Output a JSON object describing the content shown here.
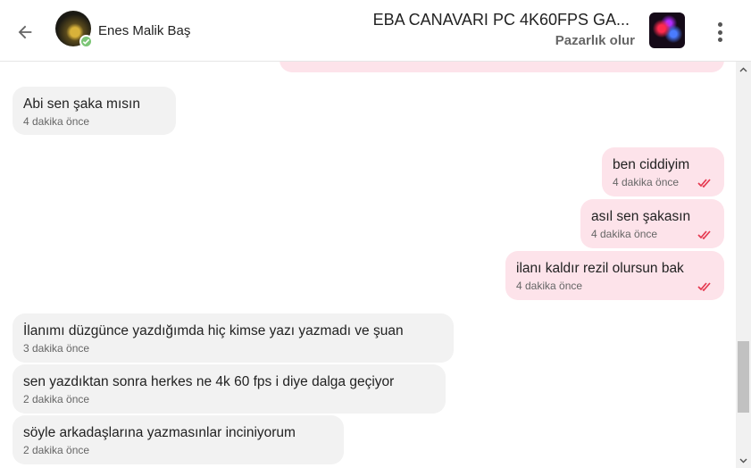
{
  "header": {
    "back_icon": "arrow-left-icon",
    "user_name": "Enes Malik Baş",
    "verified_icon": "check-badge-icon",
    "listing_title": "EBA CANAVARI PC 4K60FPS GA...",
    "listing_subtitle": "Pazarlık olur",
    "more_icon": "more-vertical-icon"
  },
  "messages": [
    {
      "side": "out",
      "text": "",
      "time": ""
    },
    {
      "side": "in",
      "text": "Abi sen şaka mısın",
      "time": "4 dakika önce"
    },
    {
      "side": "out",
      "text": "ben ciddiyim",
      "time": "4 dakika önce",
      "read": true
    },
    {
      "side": "out",
      "text": "asıl sen şakasın",
      "time": "4 dakika önce",
      "read": true
    },
    {
      "side": "out",
      "text": "ilanı kaldır rezil olursun bak",
      "time": "4 dakika önce",
      "read": true
    },
    {
      "side": "in",
      "text": "İlanımı düzgünce yazdığımda hiç kimse yazı yazmadı ve şuan",
      "time": "3 dakika önce"
    },
    {
      "side": "in",
      "text": "sen yazdıktan sonra herkes ne 4k 60 fps i diye dalga geçiyor",
      "time": "2 dakika önce"
    },
    {
      "side": "in",
      "text": "söyle arkadaşlarına yazmasınlar inciniyorum",
      "time": "2 dakika önce"
    }
  ],
  "colors": {
    "incoming_bubble": "#f2f2f2",
    "outgoing_bubble": "#fde3ea",
    "read_ticks": "#e53950",
    "verified_badge": "#7cc576"
  }
}
